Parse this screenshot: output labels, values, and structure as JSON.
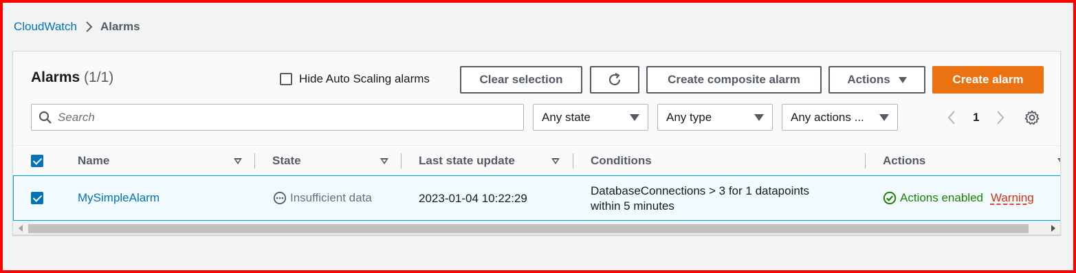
{
  "breadcrumb": {
    "parent": "CloudWatch",
    "current": "Alarms"
  },
  "header": {
    "title": "Alarms",
    "count": "(1/1)",
    "hide_autoscaling_label": "Hide Auto Scaling alarms",
    "hide_autoscaling_checked": false,
    "clear_selection_label": "Clear selection",
    "create_composite_label": "Create composite alarm",
    "actions_label": "Actions",
    "create_alarm_label": "Create alarm"
  },
  "filters": {
    "search_placeholder": "Search",
    "state_value": "Any state",
    "type_value": "Any type",
    "actions_value": "Any actions ..."
  },
  "pagination": {
    "current_page": "1"
  },
  "table": {
    "columns": [
      "Name",
      "State",
      "Last state update",
      "Conditions",
      "Actions"
    ],
    "rows": [
      {
        "selected": true,
        "name": "MySimpleAlarm",
        "state": "Insufficient data",
        "last_update": "2023-01-04 10:22:29",
        "conditions_line1": "DatabaseConnections > 3 for 1 datapoints",
        "conditions_line2": "within 5 minutes",
        "actions_status": "Actions enabled",
        "actions_warning": "Warning"
      }
    ]
  },
  "colors": {
    "primary": "#ec7211",
    "link": "#0073bb",
    "success": "#1d8102",
    "warning": "#d13212",
    "frame": "#ff0000"
  }
}
